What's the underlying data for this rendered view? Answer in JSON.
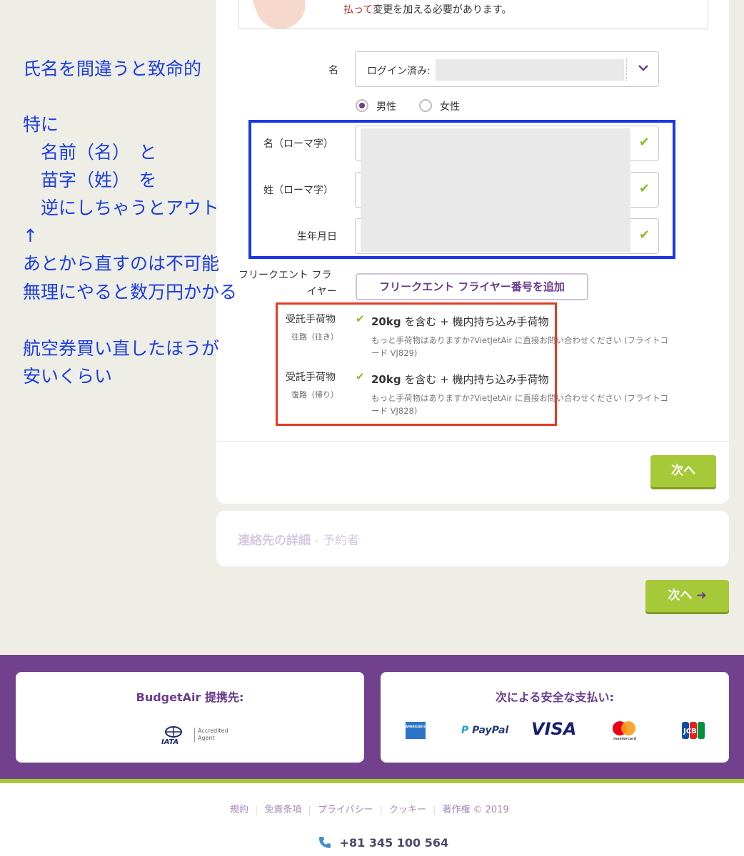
{
  "annotations": {
    "line1": "氏名を間違うと致命的",
    "line2": "特に",
    "line3": "　名前（名）　と",
    "line4": "　苗字（姓）　を",
    "line5": "　逆にしちゃうとアウト",
    "line6": "↑",
    "line7": "あとから直すのは不可能",
    "line8": "無理にやると数万円かかる",
    "line9": "航空券買い直したほうが",
    "line10": "安いくらい"
  },
  "notice": {
    "red_text": "払って",
    "text": "変更を加える必要があります。"
  },
  "form": {
    "name_label": "名",
    "name_select_value": "ログイン済み:",
    "gender": {
      "male": "男性",
      "female": "女性",
      "selected": "male"
    },
    "first_name_roman_label": "名（ローマ字）",
    "last_name_roman_label": "姓（ローマ字）",
    "birthdate_label": "生年月日",
    "frequent_flyer_label_1": "フリークエント フラ",
    "frequent_flyer_label_2": "イヤー",
    "frequent_flyer_button": "フリークエント フライヤー番号を追加",
    "baggage": [
      {
        "title": "受託手荷物",
        "direction": "往路（往き）",
        "allowance_bold": "20kg",
        "allowance_rest": "を含む + 機内持ち込み手荷物",
        "note": "もっと手荷物はありますか?VietJetAir に直接お問い合わせください (フライトコード VJ829)"
      },
      {
        "title": "受託手荷物",
        "direction": "復路（帰り）",
        "allowance_bold": "20kg",
        "allowance_rest": "を含む + 機内持ち込み手荷物",
        "note": "もっと手荷物はありますか?VietJetAir に直接お問い合わせください (フライトコード VJ828)"
      }
    ],
    "next_button": "次へ"
  },
  "contact": {
    "title": "連絡先の詳細",
    "sep": " - ",
    "subtitle": "予約者"
  },
  "next_button_2": "次へ",
  "next_button_2_arrow": "➜",
  "footer": {
    "partner_title": "BudgetAir 提携先:",
    "iata_text": "IATA",
    "iata_accredited": "Accredited",
    "iata_agent": "Agent",
    "payment_title": "次による安全な支払い:",
    "payments": [
      "AMERICAN EXPRESS",
      "PayPal",
      "VISA",
      "mastercard",
      "JCB"
    ],
    "links": [
      "規約",
      "免責条項",
      "プライバシー",
      "クッキー",
      "著作権 © 2019"
    ],
    "phone": "+81 345 100 564"
  },
  "colors": {
    "brand_purple": "#71418e",
    "accent_green": "#a6c93a",
    "annotation_blue": "#1a3ee0",
    "highlight_blue": "#1937e6",
    "highlight_red": "#e33b22"
  }
}
